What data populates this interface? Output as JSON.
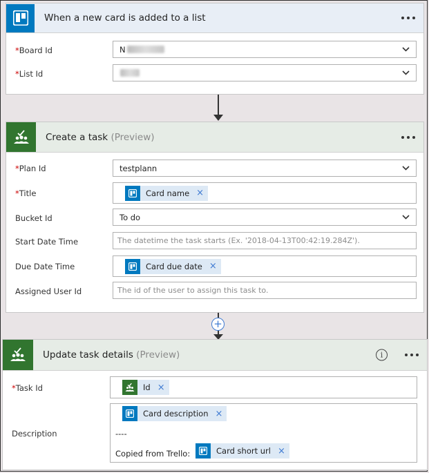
{
  "trigger": {
    "title": "When a new card is added to a list",
    "fields": [
      {
        "label": "Board Id",
        "required": true,
        "value": "N"
      },
      {
        "label": "List Id",
        "required": true,
        "value": ""
      }
    ]
  },
  "create_task": {
    "title": "Create a task",
    "preview": "(Preview)",
    "fields": {
      "plan": {
        "label": "Plan Id",
        "value": "testplann"
      },
      "title": {
        "label": "Title",
        "token": "Card name"
      },
      "bucket": {
        "label": "Bucket Id",
        "value": "To do"
      },
      "start": {
        "label": "Start Date Time",
        "placeholder": "The datetime the task starts (Ex. '2018-04-13T00:42:19.284Z')."
      },
      "due": {
        "label": "Due Date Time",
        "token": "Card due date"
      },
      "assigned": {
        "label": "Assigned User Id",
        "placeholder": "The id of the user to assign this task to."
      }
    }
  },
  "update_task": {
    "title": "Update task details",
    "preview": "(Preview)",
    "fields": {
      "task": {
        "label": "Task Id",
        "token": "Id"
      },
      "description": {
        "label": "Description",
        "token_desc": "Card description",
        "separator": "----",
        "copied_prefix": "Copied from Trello:",
        "token_url": "Card short url"
      }
    }
  },
  "required_mark": "*",
  "token_remove": "×",
  "info_glyph": "i",
  "add_step_glyph": "+",
  "icons": {
    "trello": "trello-icon",
    "planner": "planner-icon",
    "menu": "more-dots-icon",
    "dropdown": "chevron-down-icon",
    "info": "info-icon",
    "add": "add-step-icon"
  },
  "colors": {
    "trello": "#0079bf",
    "planner": "#31752f",
    "token_bg": "#dde9f5",
    "trigger_header": "#e8eef6",
    "action_header": "#e6ece6"
  }
}
